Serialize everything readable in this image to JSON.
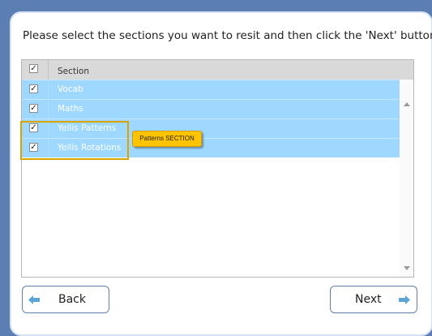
{
  "instruction": "Please select the sections you want to resit and then click the 'Next' button.",
  "table": {
    "header_check": "✓",
    "header_label": "Section",
    "rows": [
      {
        "check": "✓",
        "label": "Vocab"
      },
      {
        "check": "✓",
        "label": "Maths"
      },
      {
        "check": "✓",
        "label": "Yellis Patterns"
      },
      {
        "check": "✓",
        "label": "Yellis Rotations"
      }
    ]
  },
  "tooltip": "Patterns SECTION",
  "buttons": {
    "back": "Back",
    "next": "Next"
  },
  "colors": {
    "background": "#5b7fb3",
    "row_selected": "#9fd8ff",
    "tooltip": "#ffc400",
    "highlight_border": "#d9a400",
    "arrow": "#5ba4d6"
  },
  "icons": {
    "back": "arrow-left-icon",
    "next": "arrow-right-icon",
    "scroll_up": "caret-up-icon",
    "scroll_down": "caret-down-icon"
  }
}
